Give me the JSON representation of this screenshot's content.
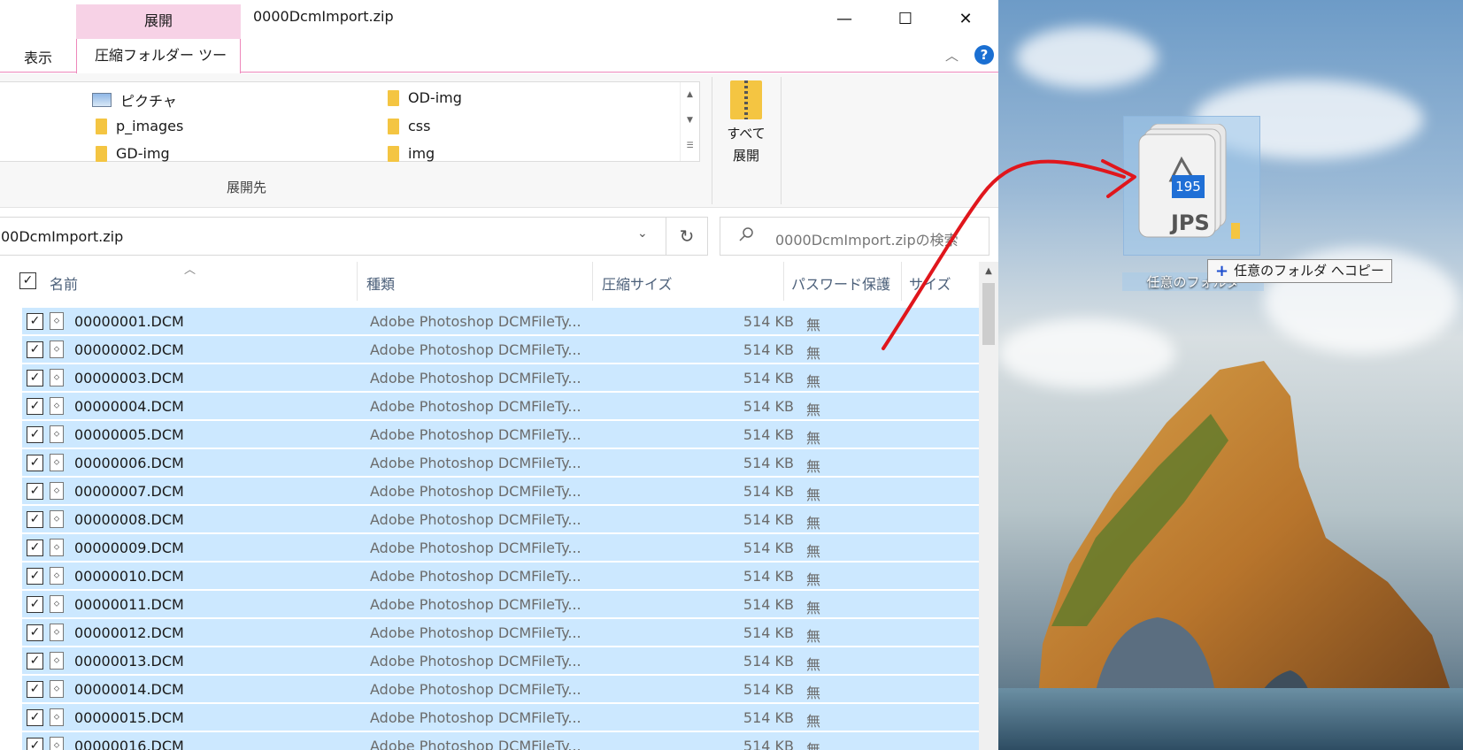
{
  "window": {
    "context_tab": "展開",
    "title": "0000DcmImport.zip",
    "minimize": "—",
    "maximize": "☐",
    "close": "✕"
  },
  "ribbon": {
    "tab_view": "表示",
    "tab_tools": "圧縮フォルダー ツール",
    "collapse": "︿",
    "help": "?",
    "destinations": [
      {
        "label": "ピクチャ",
        "icon": "pictures-icon"
      },
      {
        "label": "p_images",
        "icon": "folder-icon"
      },
      {
        "label": "GD-img",
        "icon": "folder-icon"
      },
      {
        "label": "OD-img",
        "icon": "folder-icon"
      },
      {
        "label": "css",
        "icon": "folder-icon"
      },
      {
        "label": "img",
        "icon": "folder-icon"
      }
    ],
    "group_label": "展開先",
    "extract_all_line1": "すべて",
    "extract_all_line2": "展開"
  },
  "address": {
    "path": "00DcmImport.zip",
    "search_placeholder": "0000DcmImport.zipの検索"
  },
  "columns": {
    "name": "名前",
    "type": "種類",
    "compressed_size": "圧縮サイズ",
    "password": "パスワード保護",
    "size": "サイズ"
  },
  "files": [
    {
      "name": "00000001.DCM",
      "type": "Adobe Photoshop DCMFileTy...",
      "size": "514 KB",
      "pw": "無"
    },
    {
      "name": "00000002.DCM",
      "type": "Adobe Photoshop DCMFileTy...",
      "size": "514 KB",
      "pw": "無"
    },
    {
      "name": "00000003.DCM",
      "type": "Adobe Photoshop DCMFileTy...",
      "size": "514 KB",
      "pw": "無"
    },
    {
      "name": "00000004.DCM",
      "type": "Adobe Photoshop DCMFileTy...",
      "size": "514 KB",
      "pw": "無"
    },
    {
      "name": "00000005.DCM",
      "type": "Adobe Photoshop DCMFileTy...",
      "size": "514 KB",
      "pw": "無"
    },
    {
      "name": "00000006.DCM",
      "type": "Adobe Photoshop DCMFileTy...",
      "size": "514 KB",
      "pw": "無"
    },
    {
      "name": "00000007.DCM",
      "type": "Adobe Photoshop DCMFileTy...",
      "size": "514 KB",
      "pw": "無"
    },
    {
      "name": "00000008.DCM",
      "type": "Adobe Photoshop DCMFileTy...",
      "size": "514 KB",
      "pw": "無"
    },
    {
      "name": "00000009.DCM",
      "type": "Adobe Photoshop DCMFileTy...",
      "size": "514 KB",
      "pw": "無"
    },
    {
      "name": "00000010.DCM",
      "type": "Adobe Photoshop DCMFileTy...",
      "size": "514 KB",
      "pw": "無"
    },
    {
      "name": "00000011.DCM",
      "type": "Adobe Photoshop DCMFileTy...",
      "size": "514 KB",
      "pw": "無"
    },
    {
      "name": "00000012.DCM",
      "type": "Adobe Photoshop DCMFileTy...",
      "size": "514 KB",
      "pw": "無"
    },
    {
      "name": "00000013.DCM",
      "type": "Adobe Photoshop DCMFileTy...",
      "size": "514 KB",
      "pw": "無"
    },
    {
      "name": "00000014.DCM",
      "type": "Adobe Photoshop DCMFileTy...",
      "size": "514 KB",
      "pw": "無"
    },
    {
      "name": "00000015.DCM",
      "type": "Adobe Photoshop DCMFileTy...",
      "size": "514 KB",
      "pw": "無"
    },
    {
      "name": "00000016.DCM",
      "type": "Adobe Photoshop DCMFileTy...",
      "size": "514 KB",
      "pw": "無"
    }
  ],
  "drag": {
    "count": "195",
    "file_type_label": "JPS",
    "target_folder": "任意のフォルダ",
    "copy_hint": "任意のフォルダ へコピー",
    "plus": "+"
  },
  "colors": {
    "selection": "#cce8ff",
    "context_tab": "#f7d2e6",
    "context_border": "#ee87ba",
    "badge": "#1f6fd6",
    "arrow": "#e0161c"
  }
}
